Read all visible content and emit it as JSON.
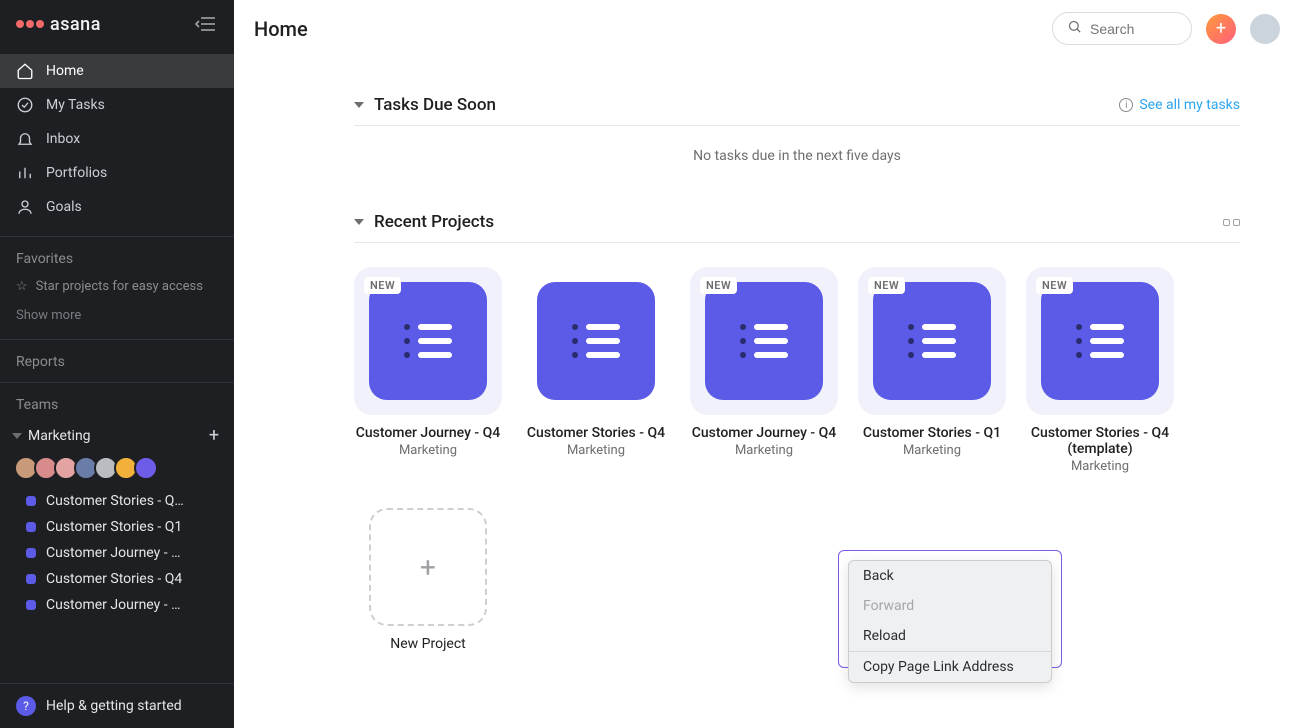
{
  "brand": "asana",
  "header": {
    "title": "Home",
    "search_placeholder": "Search"
  },
  "sidebar": {
    "nav": [
      {
        "label": "Home",
        "icon": "home-icon",
        "active": true
      },
      {
        "label": "My Tasks",
        "icon": "check-circle-icon",
        "active": false
      },
      {
        "label": "Inbox",
        "icon": "bell-icon",
        "active": false
      },
      {
        "label": "Portfolios",
        "icon": "bars-icon",
        "active": false
      },
      {
        "label": "Goals",
        "icon": "person-icon",
        "active": false
      }
    ],
    "favorites_label": "Favorites",
    "favorites_hint": "Star projects for easy access",
    "show_more": "Show more",
    "reports_label": "Reports",
    "teams_label": "Teams",
    "team_name": "Marketing",
    "projects": [
      "Customer Stories - Q…",
      "Customer Stories - Q1",
      "Customer Journey - …",
      "Customer Stories - Q4",
      "Customer Journey - …"
    ],
    "help": "Help & getting started"
  },
  "tasks_section": {
    "title": "Tasks Due Soon",
    "see_all": "See all my tasks",
    "empty": "No tasks due in the next five days"
  },
  "projects_section": {
    "title": "Recent Projects",
    "new_badge": "NEW",
    "new_project_label": "New Project",
    "cards": [
      {
        "title": "Customer Journey - Q4",
        "sub": "Marketing",
        "is_new": true
      },
      {
        "title": "Customer Stories - Q4",
        "sub": "Marketing",
        "is_new": false
      },
      {
        "title": "Customer Journey - Q4",
        "sub": "Marketing",
        "is_new": true
      },
      {
        "title": "Customer Stories - Q1",
        "sub": "Marketing",
        "is_new": true
      },
      {
        "title": "Customer Stories - Q4 (template)",
        "sub": "Marketing",
        "is_new": true
      }
    ]
  },
  "context_menu": {
    "items": [
      {
        "label": "Back",
        "disabled": false
      },
      {
        "label": "Forward",
        "disabled": true
      },
      {
        "label": "Reload",
        "disabled": false
      }
    ],
    "separator": true,
    "footer": {
      "label": "Copy Page Link Address",
      "disabled": false
    }
  }
}
